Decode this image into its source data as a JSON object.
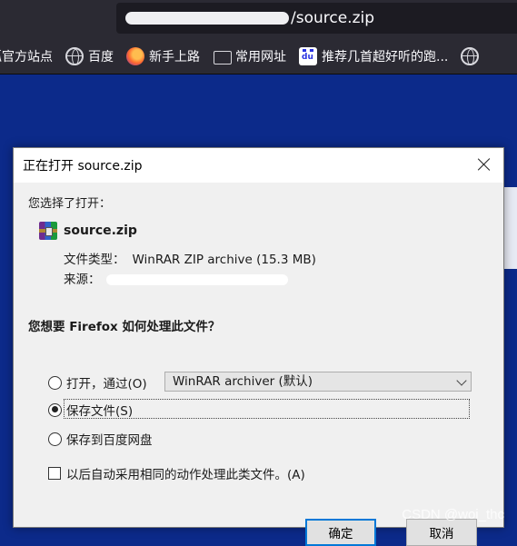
{
  "browser": {
    "url_suffix": "/source.zip",
    "bookmarks": [
      {
        "label": "狐官方站点",
        "icon": "globe-icon"
      },
      {
        "label": "百度",
        "icon": "globe-icon"
      },
      {
        "label": "新手上路",
        "icon": "firefox-icon"
      },
      {
        "label": "常用网址",
        "icon": "folder-icon"
      },
      {
        "label": "推荐几首超好听的跑...",
        "icon": "baidu-paw-icon"
      }
    ]
  },
  "dialog": {
    "title": "正在打开 source.zip",
    "chosen_label": "您选择了打开：",
    "file_name": "source.zip",
    "type_label": "文件类型：",
    "type_value": "WinRAR ZIP archive (15.3 MB)",
    "source_label": "来源：",
    "question": "您想要 Firefox 如何处理此文件？",
    "open_with_label": "打开，通过(O)",
    "open_with_app": "WinRAR archiver (默认)",
    "save_label": "保存文件(S)",
    "baidu_label": "保存到百度网盘",
    "auto_label": "以后自动采用相同的动作处理此类文件。(A)",
    "ok_label": "确定",
    "cancel_label": "取消",
    "selected_option": "save"
  },
  "watermark": "CSDN @woi_thc",
  "colors": {
    "desktop_bg": "#0c2a8a",
    "chrome_bg": "#2b2a33",
    "dialog_bg": "#f0f0f0",
    "focus_blue": "#0078d7"
  }
}
